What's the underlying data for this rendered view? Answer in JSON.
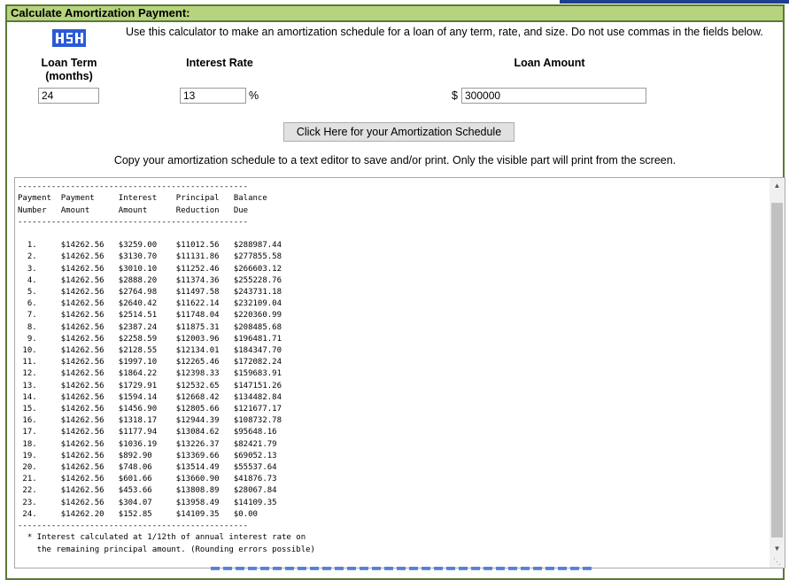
{
  "title": "Calculate Amortization Payment:",
  "intro_text": "Use this calculator to make an amortization schedule for a loan of any term, rate, and size. Do not use commas in the fields below.",
  "logo_icon": "hsh-logo-icon",
  "fields": {
    "loan_term": {
      "label": "Loan Term (months)",
      "value": "24"
    },
    "interest_rate": {
      "label": "Interest Rate",
      "value": "13",
      "suffix": "%"
    },
    "loan_amount": {
      "label": "Loan Amount",
      "value": "300000",
      "prefix": "$"
    }
  },
  "button_label": "Click Here for your Amortization Schedule",
  "copy_note": "Copy your amortization schedule to a text editor to save and/or print. Only the visible part will print from the screen.",
  "schedule_text": "                             ·  ·\n------------------------------------------------\nPayment  Payment     Interest    Principal   Balance\nNumber   Amount      Amount      Reduction   Due\n------------------------------------------------\n\n  1.     $14262.56   $3259.00    $11012.56   $288987.44\n  2.     $14262.56   $3130.70    $11131.86   $277855.58\n  3.     $14262.56   $3010.10    $11252.46   $266603.12\n  4.     $14262.56   $2888.20    $11374.36   $255228.76\n  5.     $14262.56   $2764.98    $11497.58   $243731.18\n  6.     $14262.56   $2640.42    $11622.14   $232109.04\n  7.     $14262.56   $2514.51    $11748.04   $220360.99\n  8.     $14262.56   $2387.24    $11875.31   $208485.68\n  9.     $14262.56   $2258.59    $12003.96   $196481.71\n 10.     $14262.56   $2128.55    $12134.01   $184347.70\n 11.     $14262.56   $1997.10    $12265.46   $172082.24\n 12.     $14262.56   $1864.22    $12398.33   $159683.91\n 13.     $14262.56   $1729.91    $12532.65   $147151.26\n 14.     $14262.56   $1594.14    $12668.42   $134482.84\n 15.     $14262.56   $1456.90    $12805.66   $121677.17\n 16.     $14262.56   $1318.17    $12944.39   $108732.78\n 17.     $14262.56   $1177.94    $13084.62   $95648.16\n 18.     $14262.56   $1036.19    $13226.37   $82421.79\n 19.     $14262.56   $892.90     $13369.66   $69052.13\n 20.     $14262.56   $748.06     $13514.49   $55537.64\n 21.     $14262.56   $601.66     $13660.90   $41876.73\n 22.     $14262.56   $453.66     $13808.89   $28067.84\n 23.     $14262.56   $304.07     $13958.49   $14109.35\n 24.     $14262.20   $152.85     $14109.35   $0.00\n------------------------------------------------\n  * Interest calculated at 1/12th of annual interest rate on\n    the remaining principal amount. (Rounding errors possible)\n\n------------------------------------------------"
}
